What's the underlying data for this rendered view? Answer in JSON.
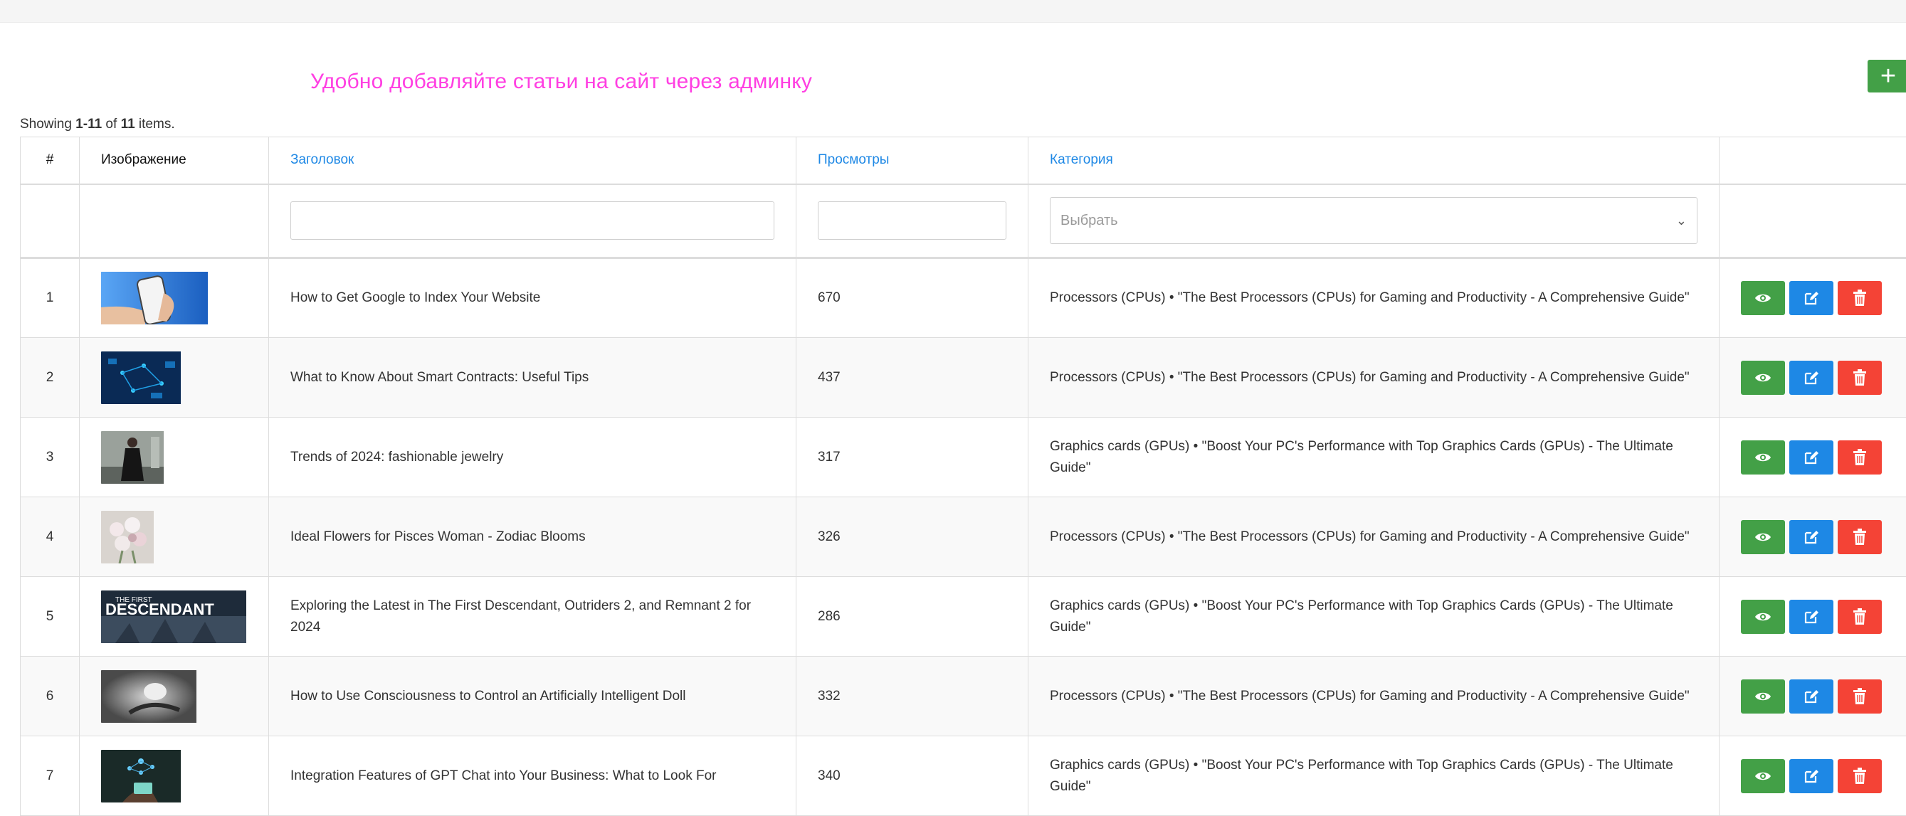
{
  "promo_text": "Удобно добавляйте статьи на сайт через админку",
  "add_button": "+",
  "summary": {
    "prefix": "Showing ",
    "range": "1-11",
    "mid": " of ",
    "total": "11",
    "suffix": " items."
  },
  "columns": {
    "num": "#",
    "image": "Изображение",
    "title": "Заголовок",
    "views": "Просмотры",
    "category": "Категория"
  },
  "filters": {
    "title_value": "",
    "views_value": "",
    "category_placeholder": "Выбрать"
  },
  "rows": [
    {
      "num": "1",
      "title": "How to Get Google to Index Your Website",
      "views": "670",
      "category": "Processors (CPUs) • \"The Best Processors (CPUs) for Gaming and Productivity - A Comprehensive Guide\"",
      "image": "hand-phone"
    },
    {
      "num": "2",
      "title": "What to Know About Smart Contracts: Useful Tips",
      "views": "437",
      "category": "Processors (CPUs) • \"The Best Processors (CPUs) for Gaming and Productivity - A Comprehensive Guide\"",
      "image": "digital-network"
    },
    {
      "num": "3",
      "title": "Trends of 2024: fashionable jewelry",
      "views": "317",
      "category": "Graphics cards (GPUs) • \"Boost Your PC's Performance with Top Graphics Cards (GPUs) - The Ultimate Guide\"",
      "image": "woman-dress"
    },
    {
      "num": "4",
      "title": "Ideal Flowers for Pisces Woman - Zodiac Blooms",
      "views": "326",
      "category": "Processors (CPUs) • \"The Best Processors (CPUs) for Gaming and Productivity - A Comprehensive Guide\"",
      "image": "flowers"
    },
    {
      "num": "5",
      "title": "Exploring the Latest in The First Descendant, Outriders 2, and Remnant 2 for 2024",
      "views": "286",
      "category": "Graphics cards (GPUs) • \"Boost Your PC's Performance with Top Graphics Cards (GPUs) - The Ultimate Guide\"",
      "image": "game-poster",
      "image_text": [
        "THE FIRST",
        "DESCENDANT"
      ]
    },
    {
      "num": "6",
      "title": "How to Use Consciousness to Control an Artificially Intelligent Doll",
      "views": "332",
      "category": "Processors (CPUs) • \"The Best Processors (CPUs) for Gaming and Productivity - A Comprehensive Guide\"",
      "image": "bw-doll"
    },
    {
      "num": "7",
      "title": "Integration Features of GPT Chat into Your Business: What to Look For",
      "views": "340",
      "category": "Graphics cards (GPUs) • \"Boost Your PC's Performance with Top Graphics Cards (GPUs) - The Ultimate Guide\"",
      "image": "ai-hand"
    }
  ],
  "colors": {
    "promo": "#ff3fe2",
    "link": "#1e88e5",
    "view": "#43a047",
    "edit": "#1e88e5",
    "delete": "#f44336"
  },
  "icons": {
    "view": "eye-icon",
    "edit": "edit-icon",
    "delete": "trash-icon",
    "filter_select": "chevron-down-icon"
  }
}
